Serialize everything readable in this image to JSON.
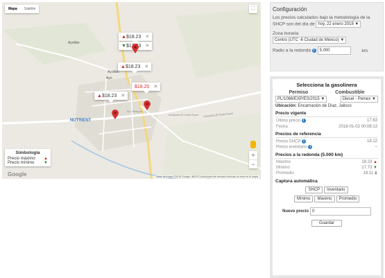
{
  "map": {
    "type_controls": {
      "map": "Mapa",
      "satellite": "Satélite"
    },
    "places": {
      "ayotlan": "Ayotlán",
      "ayotlan2": "Ayotlán",
      "nutrient": "NUTRIENT",
      "ayo_mid": "Ayo",
      "jalisco": "Jalisco"
    },
    "roads": {
      "r1": "Autopista El Guitó Road",
      "r2": "Autopista El Guitó Road",
      "r3": "Av. Obregón"
    },
    "infowindows": [
      {
        "direction": "up",
        "price": "$18.23"
      },
      {
        "direction": "down",
        "price": "$17.73"
      },
      {
        "direction": "up",
        "price": "$18.23"
      },
      {
        "direction": "none",
        "price": "$18.20"
      },
      {
        "direction": "up",
        "price": "$18.23"
      }
    ],
    "close_symbol": "✕",
    "fullscreen_symbol": "⛶",
    "legend": {
      "title": "Simbología",
      "max_label": "Precio máximo",
      "min_label": "Precio mínimo"
    },
    "zoom": {
      "in": "+",
      "out": "−"
    },
    "google": "Google",
    "attribution": "Datos del mapa ©2018 Google, INEGI   Condiciones del servicio   Informar un error en el mapa",
    "colors": {
      "up": "#c62828",
      "down": "#2e7d32",
      "pin": "#d32f2f"
    }
  },
  "config": {
    "title": "Configuración",
    "desc": "Los precios calculados bajo la metodología de la SHCP son del día de",
    "date": "hoy, 22 enero 2018",
    "tz_label": "Zona horaria:",
    "tz_value": "Centro (UTC -6 Ciudad de México)",
    "radius_label": "Radio a la redonda",
    "radius_value": "5.000",
    "radius_unit": "km"
  },
  "station": {
    "title": "Selecciona la gasolinera",
    "permiso_label": "Permiso",
    "combustible_label": "Combustible",
    "permiso_value": "PL/1066/EXP/ES/2015",
    "combustible_value": "Diesel - Pemex",
    "ubicacion_label": "Ubicación:",
    "ubicacion_value": "Encarnación de Díaz, Jalisco",
    "vigente": {
      "title": "Precio vigente",
      "ultimo_label": "Último precio",
      "ultimo_value": "17.63",
      "fecha_label": "Fecha",
      "fecha_value": "2018-01-02 00:08:13"
    },
    "referencia": {
      "title": "Precios de referencia",
      "shcp_label": "Precio SHCP",
      "shcp_value": "18.12",
      "inv_label": "Precio inventario",
      "inv_value": "–"
    },
    "redonda": {
      "title": "Precios a la redonda (5.000 km)",
      "max_label": "Máximo",
      "max_value": "18.23",
      "min_label": "Mínimo",
      "min_value": "17.73",
      "prom_label": "Promedio",
      "prom_value": "18.11"
    },
    "captura": {
      "title": "Captura automática",
      "shcp": "SHCP",
      "inventario": "Inventario",
      "minimo": "Mínimo",
      "maximo": "Máximo",
      "promedio": "Promedio"
    },
    "nuevo_label": "Nuevo precio",
    "nuevo_value": "0",
    "guardar": "Guardar"
  }
}
